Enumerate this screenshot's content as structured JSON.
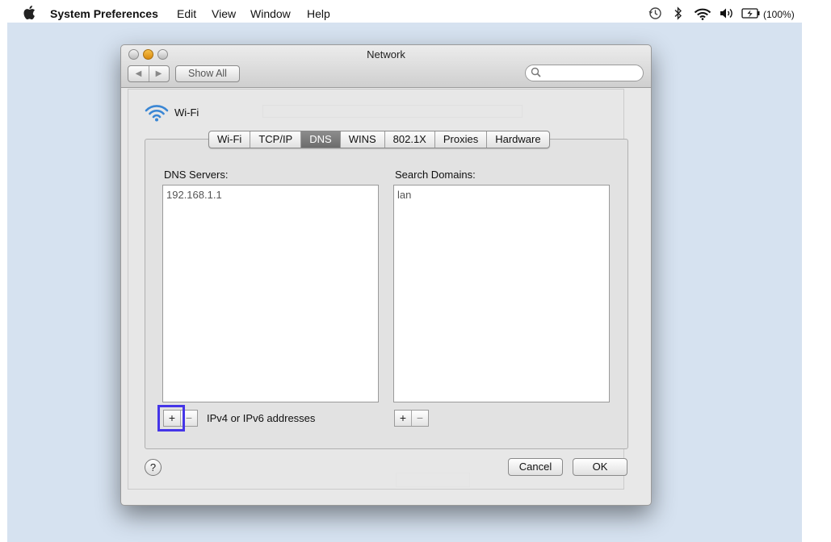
{
  "menubar": {
    "app_name": "System Preferences",
    "items": [
      "Edit",
      "View",
      "Window",
      "Help"
    ],
    "battery_text": "(100%)"
  },
  "window": {
    "title": "Network",
    "show_all": "Show All",
    "search": {
      "value": "",
      "placeholder": ""
    }
  },
  "interface": {
    "name": "Wi-Fi"
  },
  "tabs": [
    {
      "label": "Wi-Fi",
      "selected": false
    },
    {
      "label": "TCP/IP",
      "selected": false
    },
    {
      "label": "DNS",
      "selected": true
    },
    {
      "label": "WINS",
      "selected": false
    },
    {
      "label": "802.1X",
      "selected": false
    },
    {
      "label": "Proxies",
      "selected": false
    },
    {
      "label": "Hardware",
      "selected": false
    }
  ],
  "dns": {
    "label": "DNS Servers:",
    "entries": [
      "192.168.1.1"
    ],
    "hint": "IPv4 or IPv6 addresses"
  },
  "search_domains": {
    "label": "Search Domains:",
    "entries": [
      "lan"
    ]
  },
  "buttons": {
    "add": "+",
    "remove": "−",
    "help": "?",
    "cancel": "Cancel",
    "ok": "OK"
  },
  "colors": {
    "highlight": "#4535e8",
    "desktop": "#d6e2f0",
    "wifi_blue": "#3a86d4"
  }
}
